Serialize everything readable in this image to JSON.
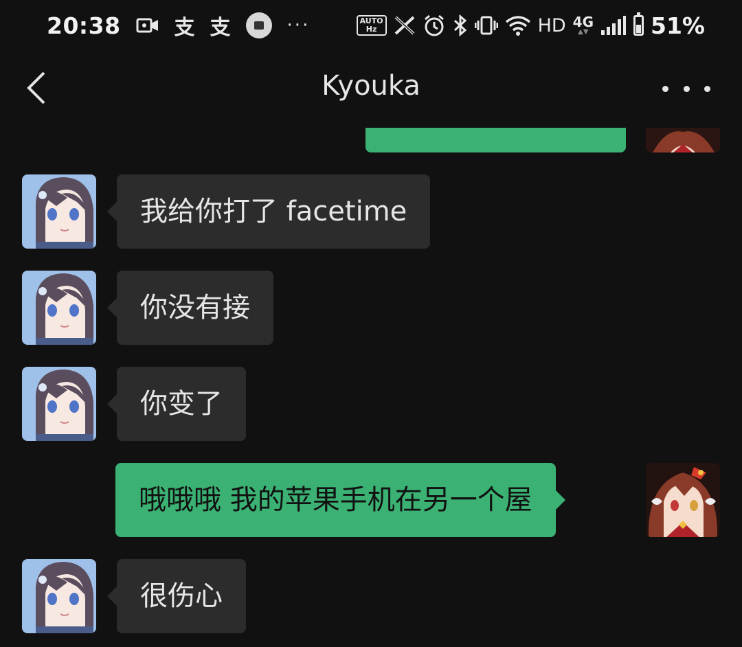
{
  "status_bar": {
    "time": "20:38",
    "left_glyphs": [
      "支",
      "支"
    ],
    "overflow_dots": "···",
    "refresh_badge_top": "AUTO",
    "refresh_badge_bottom": "Hz",
    "hd": "HD",
    "network": "4G",
    "battery_text": "51%",
    "battery_level": 0.51,
    "icons": [
      "video-record-icon",
      "alipay-icon",
      "alipay-icon",
      "bag-notification-icon",
      "auto-refresh-icon",
      "x-icon",
      "alarm-icon",
      "bluetooth-icon",
      "vibrate-icon",
      "wifi-icon",
      "signal-icon",
      "battery-icon"
    ]
  },
  "header": {
    "title": "Kyouka",
    "back_icon": "chevron-left-icon",
    "more_icon": "more-dots-icon"
  },
  "colors": {
    "background": "#111111",
    "incoming_bubble": "#2c2c2c",
    "outgoing_bubble": "#3bb273",
    "text": "#e6e6e6"
  },
  "messages": [
    {
      "direction": "out",
      "text": "",
      "partial": true
    },
    {
      "direction": "in",
      "text": "我给你打了 facetime"
    },
    {
      "direction": "in",
      "text": "你没有接"
    },
    {
      "direction": "in",
      "text": "你变了"
    },
    {
      "direction": "out",
      "text": "哦哦哦 我的苹果手机在另一个屋"
    },
    {
      "direction": "in",
      "text": "很伤心"
    }
  ]
}
